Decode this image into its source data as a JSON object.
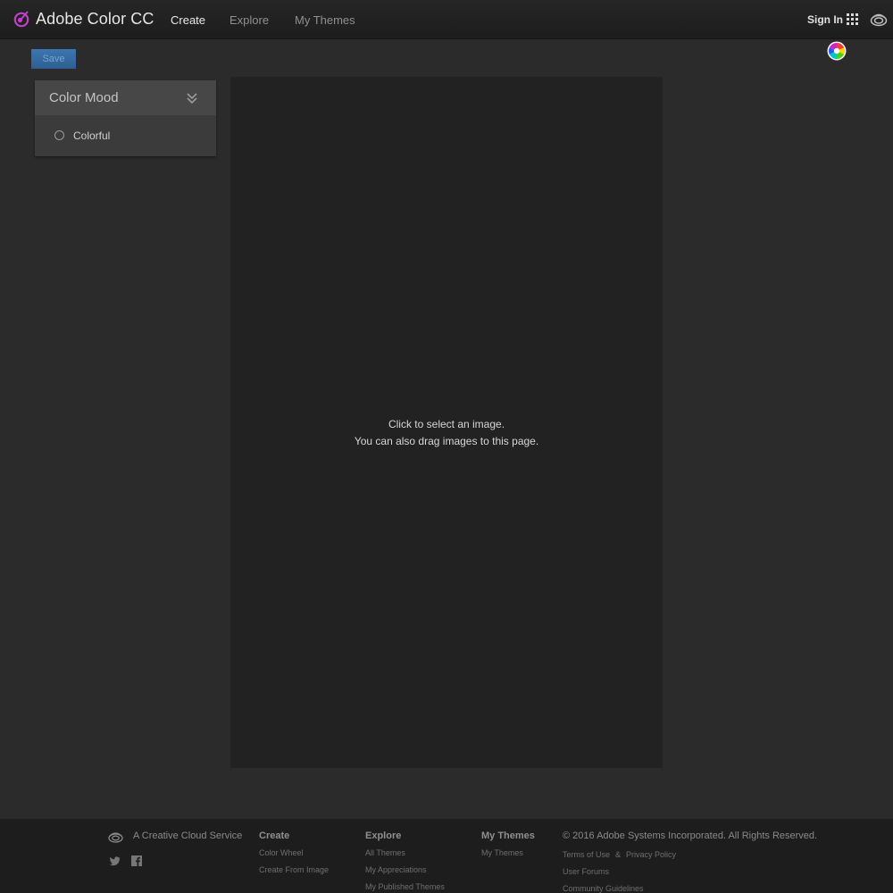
{
  "header": {
    "app_title": "Adobe Color CC",
    "nav": [
      {
        "label": "Create",
        "active": true
      },
      {
        "label": "Explore",
        "active": false
      },
      {
        "label": "My Themes",
        "active": false
      }
    ],
    "sign_in": "Sign In",
    "accent_color": "#c040c8"
  },
  "toolbar": {
    "save_label": "Save"
  },
  "mood_panel": {
    "title": "Color Mood",
    "selected_option": "Colorful"
  },
  "dropzone": {
    "line1": "Click to select an image.",
    "line2": "You can also drag images to this page."
  },
  "footer": {
    "tagline": "A Creative Cloud Service",
    "columns": [
      {
        "heading": "Create",
        "links": [
          "Color Wheel",
          "Create From Image"
        ]
      },
      {
        "heading": "Explore",
        "links": [
          "All Themes",
          "My Appreciations",
          "My Published Themes"
        ]
      },
      {
        "heading": "My Themes",
        "links": [
          "My Themes"
        ]
      }
    ],
    "copyright": "© 2016 Adobe Systems Incorporated. All Rights Reserved.",
    "legal": {
      "terms": "Terms of Use",
      "amp": "&",
      "privacy": "Privacy Policy",
      "forums": "User Forums",
      "guidelines": "Community Guidelines"
    }
  }
}
